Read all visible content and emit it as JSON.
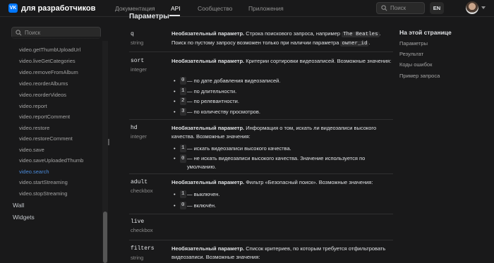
{
  "header": {
    "logo_text": "VK",
    "brand": "для разработчиков",
    "nav": [
      "Документация",
      "API",
      "Сообщество",
      "Приложения"
    ],
    "active_nav": "API",
    "search_placeholder": "Поиск",
    "lang": "EN"
  },
  "sidebar": {
    "search_placeholder": "Поиск",
    "items": [
      "video.getThumbUploadUrl",
      "video.liveGetCategories",
      "video.removeFromAlbum",
      "video.reorderAlbums",
      "video.reorderVideos",
      "video.report",
      "video.reportComment",
      "video.restore",
      "video.restoreComment",
      "video.save",
      "video.saveUploadedThumb",
      "video.search",
      "video.startStreaming",
      "video.stopStreaming"
    ],
    "active_item": "video.search",
    "sections": [
      "Wall",
      "Widgets"
    ]
  },
  "main": {
    "heading": "Параметры",
    "params": {
      "q": {
        "name": "q",
        "type": "string",
        "required": "Необязательный параметр.",
        "text1": " Строка поискового запроса, например ",
        "code1": "The Beatles",
        "text2": ".",
        "text3": "Поиск по пустому запросу возможен только при наличии параметра ",
        "code2": "owner_id",
        "text4": "."
      },
      "sort": {
        "name": "sort",
        "type": "integer",
        "required": "Необязательный параметр.",
        "text": " Критерии сортировки видеозаписей. Возможные значения:",
        "options": [
          {
            "code": "0",
            "text": "— по дате добавления видеозаписей."
          },
          {
            "code": "1",
            "text": "— по длительности."
          },
          {
            "code": "2",
            "text": "— по релевантности."
          },
          {
            "code": "3",
            "text": "— по количеству просмотров."
          }
        ]
      },
      "hd": {
        "name": "hd",
        "type": "integer",
        "required": "Необязательный параметр.",
        "text": " Информация о том, искать ли видеозаписи высокого качества. Возможные значения:",
        "options": [
          {
            "code": "1",
            "text": "— искать видеозаписи высокого качества."
          },
          {
            "code": "0",
            "text": "— не искать видеозаписи высокого качества. Значение используется по умолчанию."
          }
        ]
      },
      "adult": {
        "name": "adult",
        "type": "checkbox",
        "required": "Необязательный параметр.",
        "text": " Фильтр «Безопасный поиск». Возможные значения:",
        "options": [
          {
            "code": "1",
            "text": "— выключен."
          },
          {
            "code": "0",
            "text": "— включён."
          }
        ]
      },
      "live": {
        "name": "live",
        "type": "checkbox"
      },
      "filters": {
        "name": "filters",
        "type": "string",
        "required": "Необязательный параметр.",
        "text": " Список критериев, по которым требуется отфильтровать видеозаписи. Возможные значения:"
      }
    }
  },
  "toc": {
    "title": "На этой странице",
    "items": [
      "Параметры",
      "Результат",
      "Коды ошибок",
      "Пример запроса"
    ]
  },
  "colors": {
    "background": "#19191a",
    "accent": "#0077ff",
    "link_active": "#4a8ad9"
  }
}
